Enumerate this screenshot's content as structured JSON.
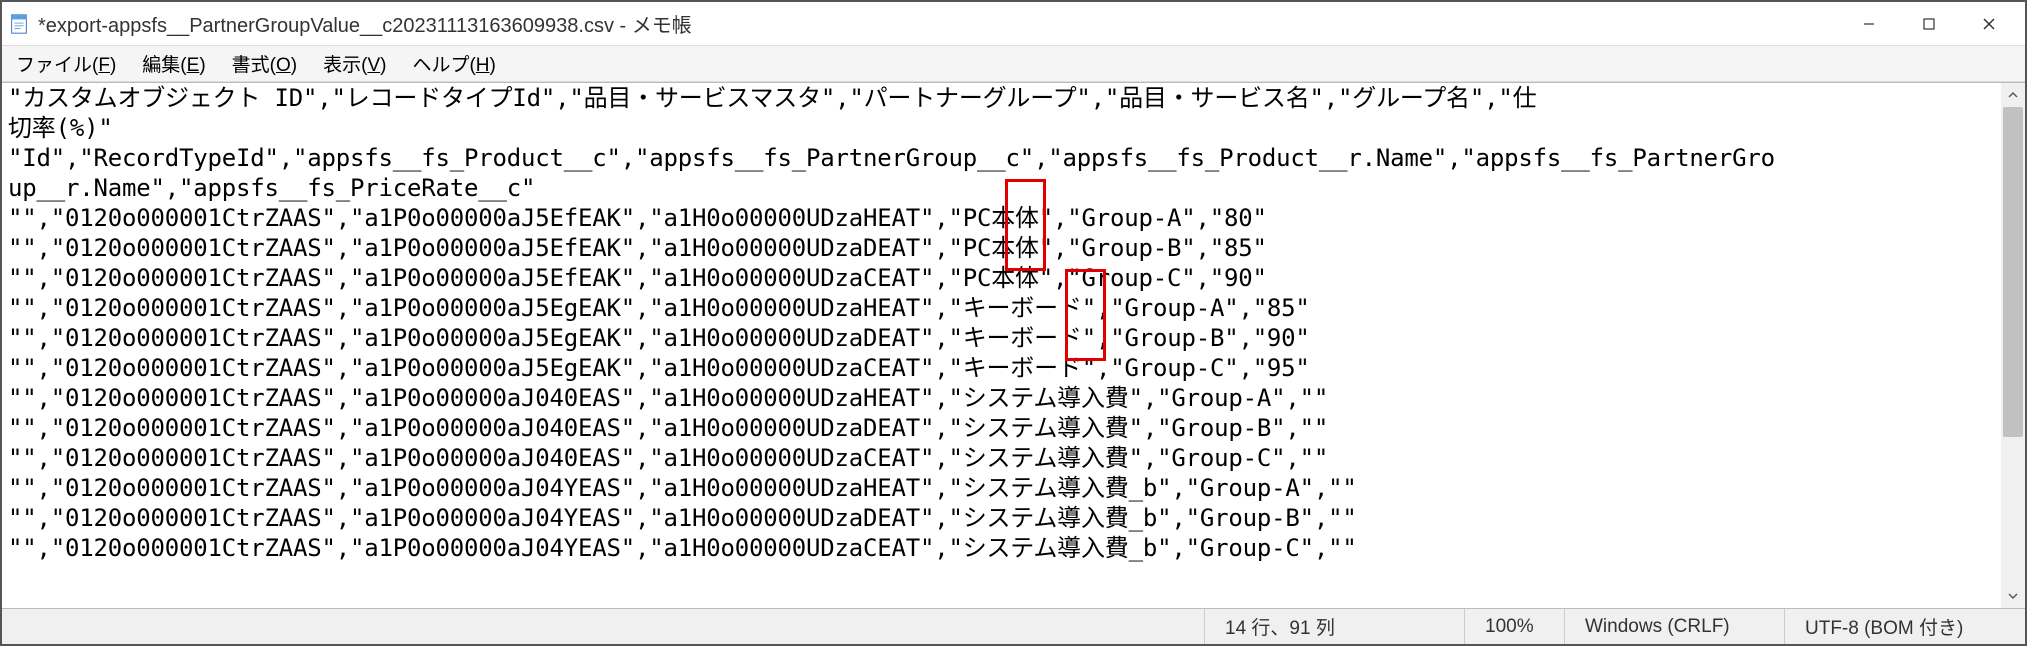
{
  "window": {
    "title": "*export-appsfs__PartnerGroupValue__c20231113163609938.csv - メモ帳"
  },
  "menu": {
    "file": {
      "label": "ファイル",
      "accel": "F"
    },
    "edit": {
      "label": "編集",
      "accel": "E"
    },
    "format": {
      "label": "書式",
      "accel": "O"
    },
    "view": {
      "label": "表示",
      "accel": "V"
    },
    "help": {
      "label": "ヘルプ",
      "accel": "H"
    }
  },
  "content": {
    "lines": [
      "\"カスタムオブジェクト ID\",\"レコードタイプId\",\"品目・サービスマスタ\",\"パートナーグループ\",\"品目・サービス名\",\"グループ名\",\"仕",
      "切率(%)\"",
      "\"Id\",\"RecordTypeId\",\"appsfs__fs_Product__c\",\"appsfs__fs_PartnerGroup__c\",\"appsfs__fs_Product__r.Name\",\"appsfs__fs_PartnerGro",
      "up__r.Name\",\"appsfs__fs_PriceRate__c\"",
      "\"\",\"0120o000001CtrZAAS\",\"a1P0o00000aJ5EfEAK\",\"a1H0o00000UDzaHEAT\",\"PC本体\",\"Group-A\",\"80\"",
      "\"\",\"0120o000001CtrZAAS\",\"a1P0o00000aJ5EfEAK\",\"a1H0o00000UDzaDEAT\",\"PC本体\",\"Group-B\",\"85\"",
      "\"\",\"0120o000001CtrZAAS\",\"a1P0o00000aJ5EfEAK\",\"a1H0o00000UDzaCEAT\",\"PC本体\",\"Group-C\",\"90\"",
      "\"\",\"0120o000001CtrZAAS\",\"a1P0o00000aJ5EgEAK\",\"a1H0o00000UDzaHEAT\",\"キーボード\",\"Group-A\",\"85\"",
      "\"\",\"0120o000001CtrZAAS\",\"a1P0o00000aJ5EgEAK\",\"a1H0o00000UDzaDEAT\",\"キーボード\",\"Group-B\",\"90\"",
      "\"\",\"0120o000001CtrZAAS\",\"a1P0o00000aJ5EgEAK\",\"a1H0o00000UDzaCEAT\",\"キーボード\",\"Group-C\",\"95\"",
      "\"\",\"0120o000001CtrZAAS\",\"a1P0o00000aJ040EAS\",\"a1H0o00000UDzaHEAT\",\"システム導入費\",\"Group-A\",\"\"",
      "\"\",\"0120o000001CtrZAAS\",\"a1P0o00000aJ040EAS\",\"a1H0o00000UDzaDEAT\",\"システム導入費\",\"Group-B\",\"\"",
      "\"\",\"0120o000001CtrZAAS\",\"a1P0o00000aJ040EAS\",\"a1H0o00000UDzaCEAT\",\"システム導入費\",\"Group-C\",\"\"",
      "\"\",\"0120o000001CtrZAAS\",\"a1P0o00000aJ04YEAS\",\"a1H0o00000UDzaHEAT\",\"システム導入費_b\",\"Group-A\",\"\"",
      "\"\",\"0120o000001CtrZAAS\",\"a1P0o00000aJ04YEAS\",\"a1H0o00000UDzaDEAT\",\"システム導入費_b\",\"Group-B\",\"\"",
      "\"\",\"0120o000001CtrZAAS\",\"a1P0o00000aJ04YEAS\",\"a1H0o00000UDzaCEAT\",\"システム導入費_b\",\"Group-C\",\"\""
    ]
  },
  "status": {
    "pos": "14 行、91 列",
    "zoom": "100%",
    "eol": "Windows (CRLF)",
    "encoding": "UTF-8 (BOM 付き)"
  }
}
